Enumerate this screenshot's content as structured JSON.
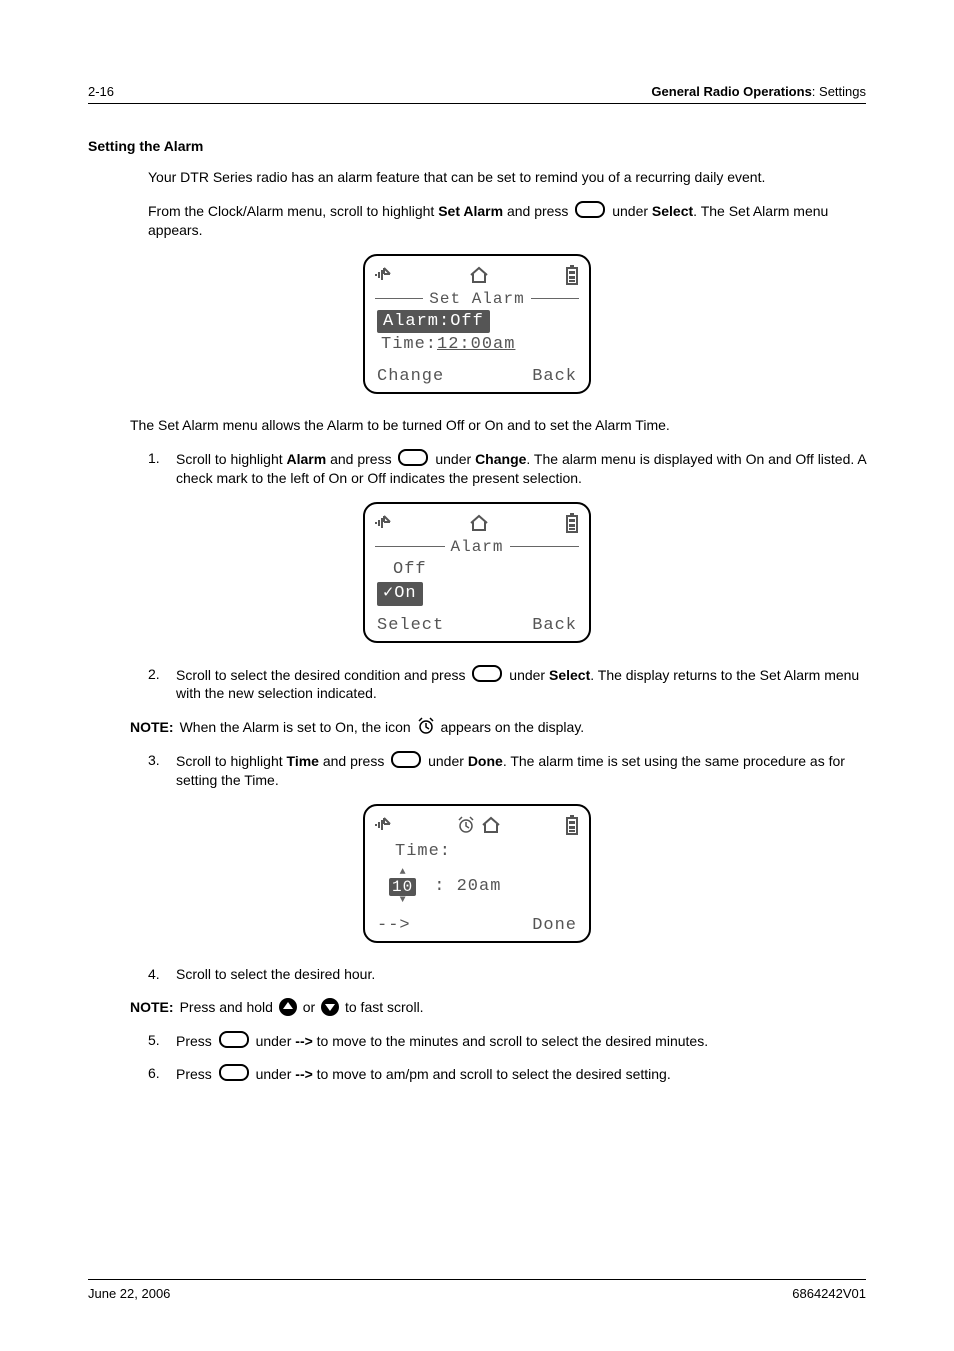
{
  "header": {
    "page_num": "2-16",
    "title_prefix": "General Radio Operations",
    "title_suffix": ": Settings"
  },
  "section": {
    "title": "Setting the Alarm",
    "intro1": "Your DTR Series radio has an alarm feature that can be set to remind you of a recurring daily event.",
    "intro2a": "From the Clock/Alarm menu, scroll to highlight ",
    "intro2_bold1": "Set Alarm",
    "intro2b": " and press ",
    "intro2c": " under ",
    "intro2_bold2": "Select",
    "intro2d": ". The Set Alarm menu appears."
  },
  "lcd1": {
    "title": "Set Alarm",
    "line1": "Alarm:Off",
    "line2a": "Time:",
    "line2b": "12:00am",
    "left": "Change",
    "right": "Back"
  },
  "mid_para": "The Set Alarm menu allows the Alarm to be turned Off or On and to set the Alarm Time.",
  "step1": {
    "num": "1.",
    "a": "Scroll to highlight ",
    "bold1": "Alarm",
    "b": " and press ",
    "c": " under ",
    "bold2": "Change",
    "d": ". The alarm menu is displayed with On and Off listed. A check mark to the left of On or Off indicates the present selection."
  },
  "lcd2": {
    "title": "Alarm",
    "line1": "Off",
    "line2": "✓On",
    "left": "Select",
    "right": "Back"
  },
  "step2": {
    "num": "2.",
    "a": "Scroll to select the desired condition and press ",
    "b": " under ",
    "bold1": "Select",
    "c": ". The display returns to the Set Alarm menu with the new selection indicated."
  },
  "note1": {
    "label": "NOTE:",
    "a": "When the Alarm is set to On, the icon ",
    "b": " appears on the display."
  },
  "step3": {
    "num": "3.",
    "a": "Scroll to highlight ",
    "bold1": "Time",
    "b": " and press ",
    "c": " under ",
    "bold2": "Done",
    "d": ". The alarm time is set using the same procedure as for setting the Time."
  },
  "lcd3": {
    "label": "Time:",
    "hour": "10",
    "rest": ":   20am",
    "left": "-->",
    "right": "Done"
  },
  "step4": {
    "num": "4.",
    "text": "Scroll to select the desired hour."
  },
  "note2": {
    "label": "NOTE:",
    "a": "Press and hold ",
    "b": " or ",
    "c": " to fast scroll."
  },
  "step5": {
    "num": "5.",
    "a": "Press ",
    "b": " under ",
    "bold1": "-->",
    "c": " to move to the minutes and scroll to select the desired minutes."
  },
  "step6": {
    "num": "6.",
    "a": "Press ",
    "b": " under ",
    "bold1": "-->",
    "c": " to move to am/pm and scroll to select the desired setting."
  },
  "footer": {
    "date": "June 22, 2006",
    "docnum": "6864242V01"
  }
}
